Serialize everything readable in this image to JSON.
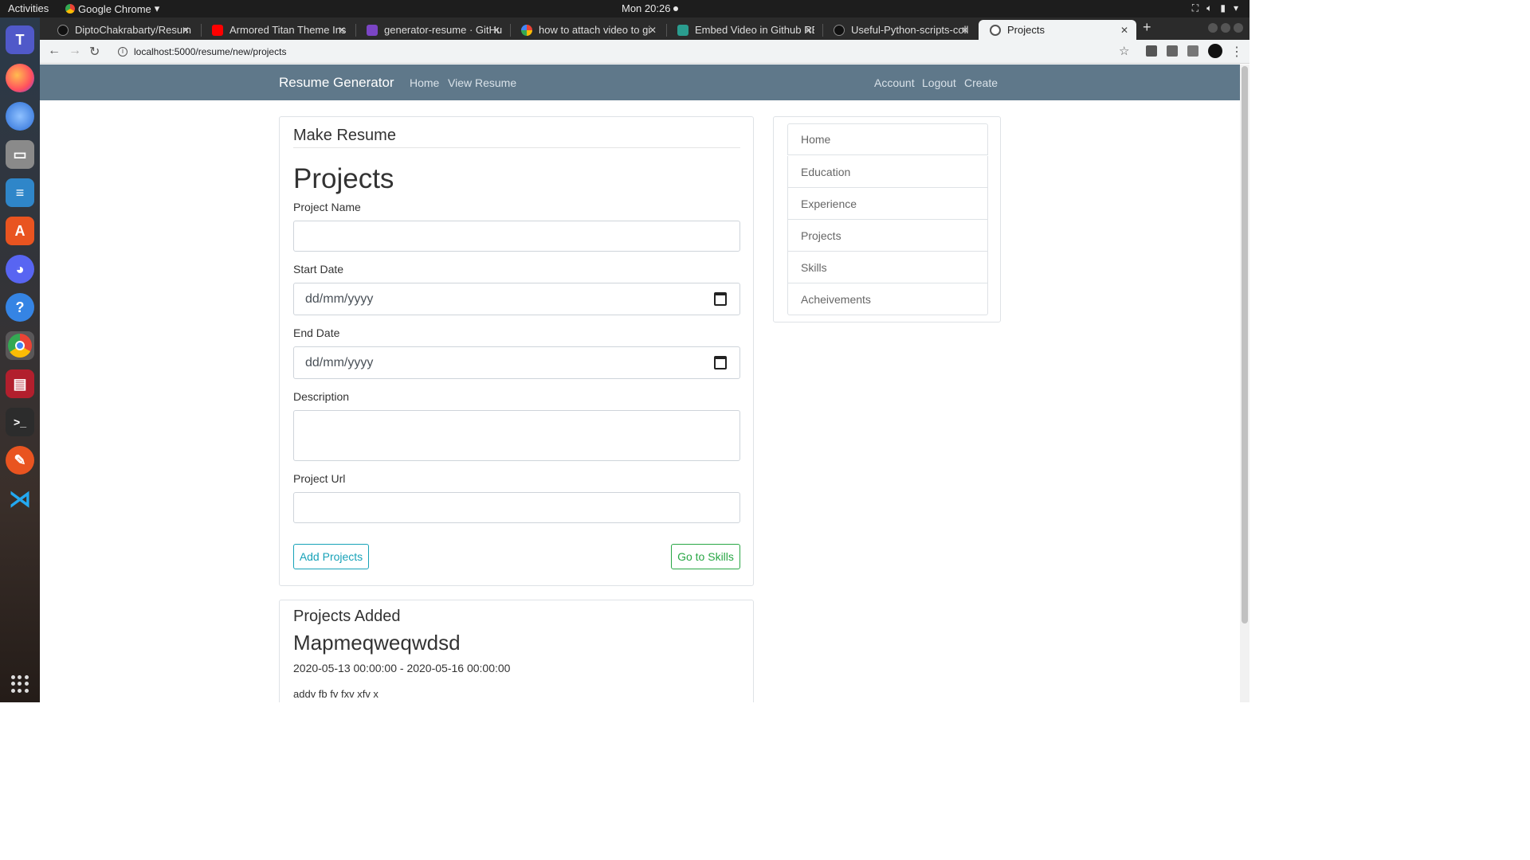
{
  "topbar": {
    "activities": "Activities",
    "app_name": "Google Chrome",
    "clock": "Mon 20:26"
  },
  "dock": {
    "items": [
      "teams-icon",
      "firefox-icon",
      "thunderbird-icon",
      "files-icon",
      "writer-icon",
      "software-icon",
      "discord-icon",
      "help-icon",
      "chrome-icon",
      "app-icon",
      "terminal-icon",
      "draw-icon",
      "vscode-icon"
    ]
  },
  "tabs": [
    {
      "title": "DiptoChakrabarty/Resum",
      "close": "✕"
    },
    {
      "title": "Armored Titan Theme Ins",
      "close": "✕"
    },
    {
      "title": "generator-resume · GitHu",
      "close": "✕"
    },
    {
      "title": "how to attach video to gi",
      "close": "✕"
    },
    {
      "title": "Embed Video in Github RE",
      "close": "✕"
    },
    {
      "title": "Useful-Python-scripts-coll",
      "close": "✕"
    },
    {
      "title": "Projects",
      "close": "✕"
    }
  ],
  "new_tab": "+",
  "toolbar": {
    "url": "localhost:5000/resume/new/projects"
  },
  "site": {
    "brand": "Resume Generator",
    "nav_left": [
      "Home",
      "View Resume"
    ],
    "nav_right": [
      "Account",
      "Logout",
      "Create"
    ]
  },
  "form": {
    "legend": "Make Resume",
    "heading": "Projects",
    "project_name_label": "Project Name",
    "project_name_value": "",
    "start_date_label": "Start Date",
    "start_date_placeholder": "dd/mm/yyyy",
    "end_date_label": "End Date",
    "end_date_placeholder": "dd/mm/yyyy",
    "description_label": "Description",
    "description_value": "",
    "project_url_label": "Project Url",
    "project_url_value": "",
    "add_button": "Add Projects",
    "next_button": "Go to Skills"
  },
  "sidebar": {
    "items": [
      "Home",
      "Education",
      "Experience",
      "Projects",
      "Skills",
      "Acheivements"
    ]
  },
  "projects_added": {
    "legend": "Projects Added",
    "items": [
      {
        "name": "Mapmeqweqwdsd",
        "dates": "2020-05-13 00:00:00 - 2020-05-16 00:00:00",
        "description": "addv fb fv fxv xfv x"
      }
    ]
  },
  "colors": {
    "navbar": "#5f788a",
    "info": "#17a2b8",
    "success": "#28a745"
  }
}
